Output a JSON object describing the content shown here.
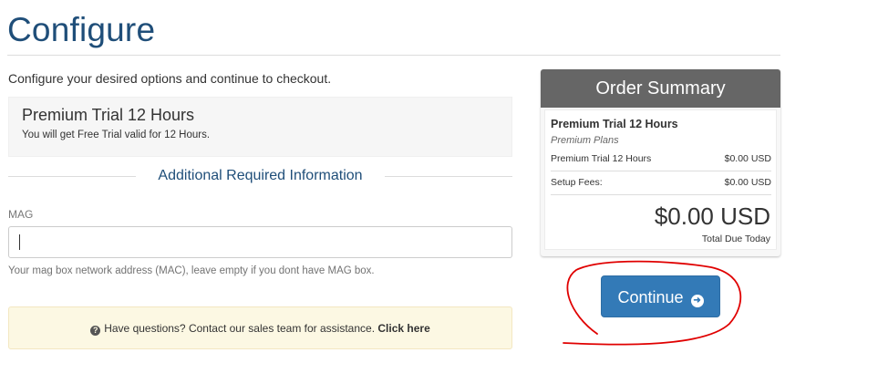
{
  "page": {
    "title": "Configure",
    "intro": "Configure your desired options and continue to checkout."
  },
  "product": {
    "name": "Premium Trial 12 Hours",
    "description": "You will get Free Trial valid for 12 Hours."
  },
  "additional_info": {
    "heading": "Additional Required Information",
    "mag_label": "MAG",
    "mag_value": "",
    "mag_help": "Your mag box network address (MAC), leave empty if you dont have MAG box."
  },
  "assistance": {
    "icon": "question-circle-icon",
    "text": "Have questions? Contact our sales team for assistance.",
    "link": "Click here",
    "background": "#fcf8e3"
  },
  "order_summary": {
    "header": "Order Summary",
    "product_name": "Premium Trial 12 Hours",
    "product_group": "Premium Plans",
    "line_item_label": "Premium Trial 12 Hours",
    "line_item_price": "$0.00 USD",
    "setup_label": "Setup Fees:",
    "setup_price": "$0.00 USD",
    "total": "$0.00 USD",
    "total_label": "Total Due Today",
    "header_color": "#666666"
  },
  "actions": {
    "continue_label": "Continue",
    "continue_icon": "arrow-circle-right-icon",
    "button_color": "#337ab7"
  },
  "annotation": {
    "type": "hand-drawn red circle around Continue button",
    "color": "#e00000"
  }
}
